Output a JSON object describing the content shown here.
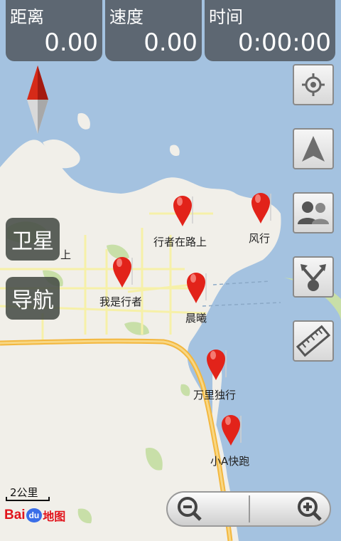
{
  "stats": {
    "distance": {
      "label": "距离",
      "value": "0.00"
    },
    "speed": {
      "label": "速度",
      "value": "0.00"
    },
    "time": {
      "label": "时间",
      "value": "0:00:00"
    }
  },
  "mode_buttons": {
    "satellite": "卫星",
    "navigation": "导航"
  },
  "pins": [
    {
      "label": "行者在路上"
    },
    {
      "label": "风行"
    },
    {
      "label": "我是行者"
    },
    {
      "label": "晨曦"
    },
    {
      "label": "万里独行"
    },
    {
      "label": "小A快跑"
    }
  ],
  "map_text": {
    "partial_label": "上"
  },
  "side_buttons": [
    "location-icon",
    "compass-arrow-icon",
    "friends-icon",
    "share-icon",
    "ruler-icon"
  ],
  "zoom": {
    "out_icon": "zoom-out-icon",
    "in_icon": "zoom-in-icon"
  },
  "scale": {
    "text": "2公里"
  },
  "logo": {
    "bai": "Bai",
    "du": "du",
    "map": "地图"
  },
  "colors": {
    "water": "#a4c2e0",
    "land": "#f1efe9",
    "park": "#c8dfa8",
    "road": "#f6f0a8",
    "highway": "#f3b73e",
    "pin": "#e2231a",
    "panel": "#5d6772"
  }
}
